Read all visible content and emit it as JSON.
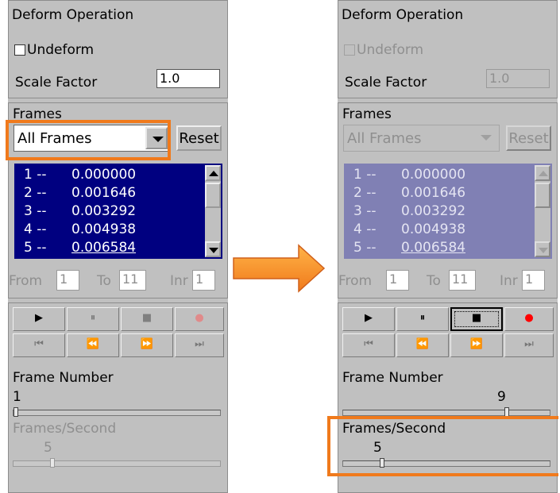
{
  "left": {
    "deform": {
      "title": "Deform Operation",
      "undeform_label": "Undeform",
      "scale_label": "Scale Factor",
      "scale_value": "1.0"
    },
    "frames": {
      "title": "Frames",
      "selected": "All Frames",
      "reset_label": "Reset",
      "items": [
        {
          "num": "1 --",
          "val": "0.000000"
        },
        {
          "num": "2 --",
          "val": "0.001646"
        },
        {
          "num": "3 --",
          "val": "0.003292"
        },
        {
          "num": "4 --",
          "val": "0.004938"
        },
        {
          "num": "5 --",
          "val": "0.006584"
        }
      ],
      "from_label": "From",
      "from_value": "1",
      "to_label": "To",
      "to_value": "11",
      "inr_label": "Inr",
      "inr_value": "1"
    },
    "controls": {
      "play": "▶",
      "pause": "⏸",
      "stop": "■",
      "record": "●",
      "first": "⏮",
      "prev": "⏪",
      "next": "⏩",
      "last": "⏭"
    },
    "frame_number_label": "Frame Number",
    "frame_number_value": "1",
    "frame_slider_level": 0.0,
    "fps_label": "Frames/Second",
    "fps_value": "5",
    "fps_slider_level": 0.18
  },
  "right": {
    "deform": {
      "title": "Deform Operation",
      "undeform_label": "Undeform",
      "scale_label": "Scale Factor",
      "scale_value": "1.0"
    },
    "frames": {
      "title": "Frames",
      "selected": "All Frames",
      "reset_label": "Reset",
      "items": [
        {
          "num": "1 --",
          "val": "0.000000"
        },
        {
          "num": "2 --",
          "val": "0.001646"
        },
        {
          "num": "3 --",
          "val": "0.003292"
        },
        {
          "num": "4 --",
          "val": "0.004938"
        },
        {
          "num": "5 --",
          "val": "0.006584"
        }
      ],
      "from_label": "From",
      "from_value": "1",
      "to_label": "To",
      "to_value": "11",
      "inr_label": "Inr",
      "inr_value": "1"
    },
    "controls": {
      "play": "▶",
      "pause": "⏸",
      "stop": "■",
      "record": "●",
      "first": "⏮",
      "prev": "⏪",
      "next": "⏩",
      "last": "⏭"
    },
    "frame_number_label": "Frame Number",
    "frame_number_value": "9",
    "frame_slider_level": 0.8,
    "fps_label": "Frames/Second",
    "fps_value": "5",
    "fps_slider_level": 0.18
  },
  "colors": {
    "highlight": "#f07a1c",
    "list_active": "#000080",
    "list_disabled": "#8080b4",
    "panel": "#c0c0c0",
    "record_red": "#ff0000",
    "record_disabled": "#e08a8a"
  }
}
